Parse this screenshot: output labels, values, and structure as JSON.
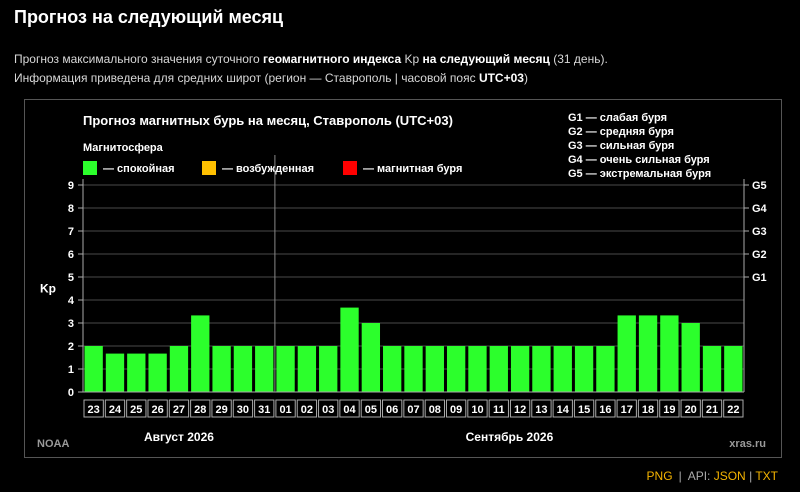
{
  "page": {
    "title": "Прогноз на следующий месяц",
    "subtitle1": {
      "t1": "Прогноз максимального значения суточного ",
      "b1": "геомагнитного индекса",
      "t2": " Kp ",
      "b2": "на следующий месяц",
      "t3": " (31 день)."
    },
    "subtitle2": {
      "t1": "Информация приведена для средних широт (регион — Ставрополь | часовой пояс ",
      "b1": "UTC+03",
      "t2": ")"
    }
  },
  "footer": {
    "png": "PNG",
    "sep": "|",
    "api_prefix": "API:",
    "json": "JSON",
    "txt": "TXT"
  },
  "colors": {
    "calm": "#2cff2c",
    "active": "#ffc000",
    "storm": "#ff0000",
    "footer_link": "#f5b400"
  },
  "chart_data": {
    "type": "bar",
    "title": "Прогноз магнитных бурь на месяц, Ставрополь (UTC+03)",
    "legend_title": "Магнитосфера",
    "legend": [
      {
        "key": "calm",
        "label": "— спокойная"
      },
      {
        "key": "active",
        "label": "— возбужденная"
      },
      {
        "key": "storm",
        "label": "— магнитная буря"
      }
    ],
    "g_legend": [
      "G1 — слабая буря",
      "G2 — средняя буря",
      "G3 — сильная буря",
      "G4 — очень сильная буря",
      "G5 — экстремальная буря"
    ],
    "ylabel": "Kp",
    "ylim": [
      0,
      9
    ],
    "yticks": [
      "0",
      "1",
      "2",
      "3",
      "4",
      "5",
      "6",
      "7",
      "8",
      "9"
    ],
    "right_ticks": [
      {
        "kp": 5,
        "label": "G1"
      },
      {
        "kp": 6,
        "label": "G2"
      },
      {
        "kp": 7,
        "label": "G3"
      },
      {
        "kp": 8,
        "label": "G4"
      },
      {
        "kp": 9,
        "label": "G5"
      }
    ],
    "grid": true,
    "categories": [
      "23",
      "24",
      "25",
      "26",
      "27",
      "28",
      "29",
      "30",
      "31",
      "01",
      "02",
      "03",
      "04",
      "05",
      "06",
      "07",
      "08",
      "09",
      "10",
      "11",
      "12",
      "13",
      "14",
      "15",
      "16",
      "17",
      "18",
      "19",
      "20",
      "21",
      "22"
    ],
    "values": [
      2.0,
      1.67,
      1.67,
      1.67,
      2.0,
      3.33,
      2.0,
      2.0,
      2.0,
      2.0,
      2.0,
      2.0,
      3.67,
      3.0,
      2.0,
      2.0,
      2.0,
      2.0,
      2.0,
      2.0,
      2.0,
      2.0,
      2.0,
      2.0,
      2.0,
      3.33,
      3.33,
      3.33,
      3.0,
      2.0,
      2.0
    ],
    "levels": [
      "calm",
      "calm",
      "calm",
      "calm",
      "calm",
      "calm",
      "calm",
      "calm",
      "calm",
      "calm",
      "calm",
      "calm",
      "calm",
      "calm",
      "calm",
      "calm",
      "calm",
      "calm",
      "calm",
      "calm",
      "calm",
      "calm",
      "calm",
      "calm",
      "calm",
      "calm",
      "calm",
      "calm",
      "calm",
      "calm",
      "calm"
    ],
    "month_labels": [
      {
        "label": "Август 2026",
        "from": 0,
        "to": 8
      },
      {
        "label": "Сентябрь 2026",
        "from": 9,
        "to": 30
      }
    ],
    "month_divider_after": 8,
    "source_left": "NOAA",
    "source_right": "xras.ru"
  }
}
